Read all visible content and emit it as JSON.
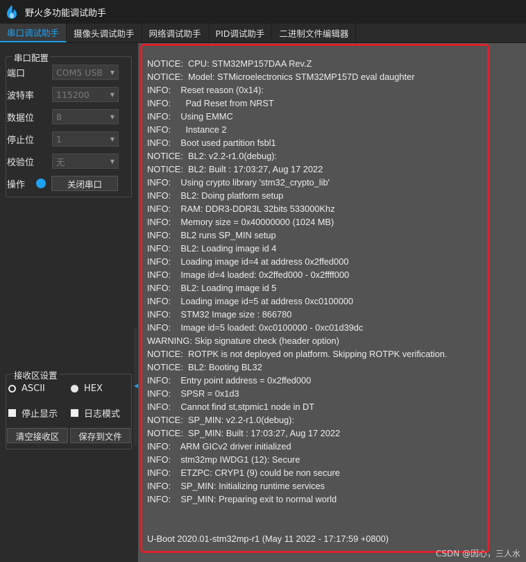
{
  "app": {
    "title": "野火多功能调试助手"
  },
  "tabs": [
    {
      "label": "串口调试助手",
      "active": true
    },
    {
      "label": "摄像头调试助手",
      "active": false
    },
    {
      "label": "网络调试助手",
      "active": false
    },
    {
      "label": "PID调试助手",
      "active": false
    },
    {
      "label": "二进制文件编辑器",
      "active": false
    }
  ],
  "serial_config": {
    "title": "串口配置",
    "port": {
      "label": "端口",
      "value": "COM5 USB"
    },
    "baud": {
      "label": "波特率",
      "value": "115200"
    },
    "databits": {
      "label": "数据位",
      "value": "8"
    },
    "stopbits": {
      "label": "停止位",
      "value": "1"
    },
    "parity": {
      "label": "校验位",
      "value": "无"
    },
    "operate": {
      "label": "操作",
      "button": "关闭串口"
    }
  },
  "receive_config": {
    "title": "接收区设置",
    "ascii": "ASCII",
    "hex": "HEX",
    "stop_display": "停止显示",
    "log_mode": "日志模式",
    "clear_button": "清空接收区",
    "save_button": "保存到文件"
  },
  "colors": {
    "accent": "#1da1f2",
    "highlight": "#e0202a",
    "terminal_bg": "#535353"
  },
  "log": [
    "NOTICE:  CPU: STM32MP157DAA Rev.Z",
    "NOTICE:  Model: STMicroelectronics STM32MP157D eval daughter",
    "INFO:    Reset reason (0x14):",
    "INFO:      Pad Reset from NRST",
    "INFO:    Using EMMC",
    "INFO:      Instance 2",
    "INFO:    Boot used partition fsbl1",
    "NOTICE:  BL2: v2.2-r1.0(debug):",
    "NOTICE:  BL2: Built : 17:03:27, Aug 17 2022",
    "INFO:    Using crypto library 'stm32_crypto_lib'",
    "INFO:    BL2: Doing platform setup",
    "INFO:    RAM: DDR3-DDR3L 32bits 533000Khz",
    "INFO:    Memory size = 0x40000000 (1024 MB)",
    "INFO:    BL2 runs SP_MIN setup",
    "INFO:    BL2: Loading image id 4",
    "INFO:    Loading image id=4 at address 0x2ffed000",
    "INFO:    Image id=4 loaded: 0x2ffed000 - 0x2ffff000",
    "INFO:    BL2: Loading image id 5",
    "INFO:    Loading image id=5 at address 0xc0100000",
    "INFO:    STM32 Image size : 866780",
    "INFO:    Image id=5 loaded: 0xc0100000 - 0xc01d39dc",
    "WARNING: Skip signature check (header option)",
    "NOTICE:  ROTPK is not deployed on platform. Skipping ROTPK verification.",
    "NOTICE:  BL2: Booting BL32",
    "INFO:    Entry point address = 0x2ffed000",
    "INFO:    SPSR = 0x1d3",
    "INFO:    Cannot find st,stpmic1 node in DT",
    "NOTICE:  SP_MIN: v2.2-r1.0(debug):",
    "NOTICE:  SP_MIN: Built : 17:03:27, Aug 17 2022",
    "INFO:    ARM GICv2 driver initialized",
    "INFO:    stm32mp IWDG1 (12): Secure",
    "INFO:    ETZPC: CRYP1 (9) could be non secure",
    "INFO:    SP_MIN: Initializing runtime services",
    "INFO:    SP_MIN: Preparing exit to normal world"
  ],
  "uboot_line": "U-Boot 2020.01-stm32mp-r1 (May 11 2022 - 17:17:59 +0800)",
  "watermark": "CSDN @因心，三人水"
}
